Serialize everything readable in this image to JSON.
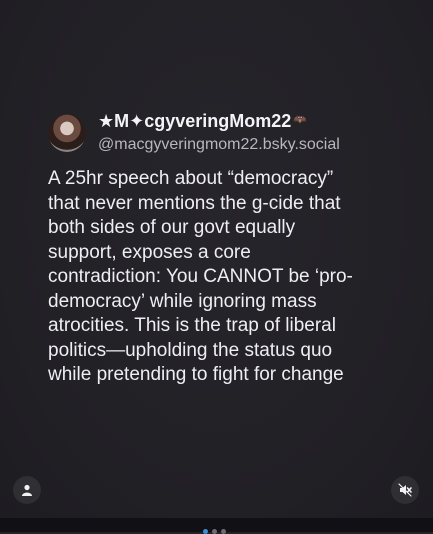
{
  "post": {
    "display_name": "★M✦cgyveringMom22",
    "name_decoration": "🦇",
    "handle": "@macgyveringmom22.bsky.social",
    "text": "A 25hr speech about “democracy”\nthat never mentions the g-cide that\nboth sides of our govt equally\nsupport, exposes a core\ncontradiction: You CANNOT be ‘pro-\ndemocracy’ while ignoring mass\natrocities. This is the trap of liberal\npolitics—upholding the status quo\nwhile pretending to fight for change"
  },
  "icons": {
    "profile": "person-icon",
    "audio": "mute-icon"
  },
  "pager": {
    "total": 3,
    "active": 1
  },
  "colors": {
    "background": "#232227",
    "text": "#efeef2",
    "accent": "#3a8fd8"
  }
}
